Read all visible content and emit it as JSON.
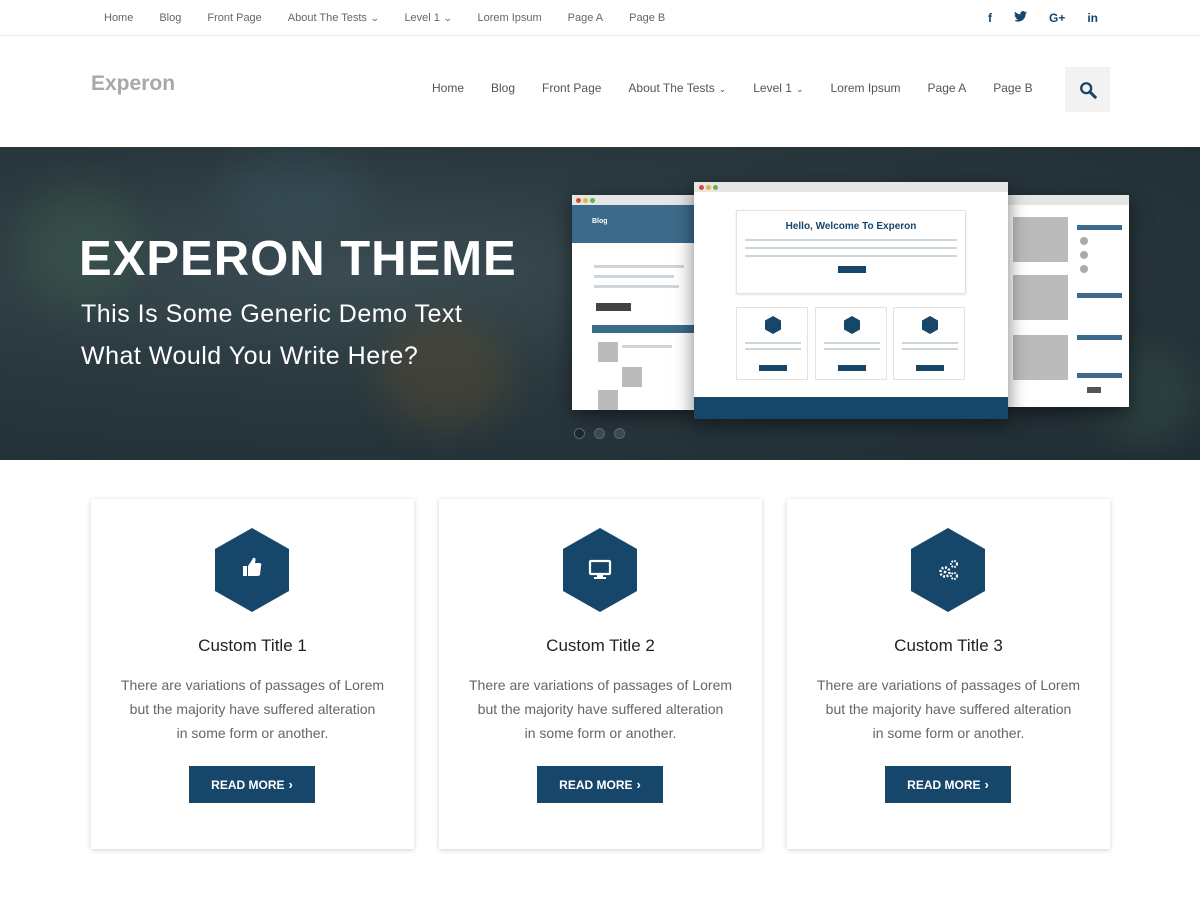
{
  "topbar": {
    "nav": [
      {
        "label": "Home"
      },
      {
        "label": "Blog"
      },
      {
        "label": "Front Page"
      },
      {
        "label": "About The Tests"
      },
      {
        "label": "Level 1"
      },
      {
        "label": "Lorem Ipsum"
      },
      {
        "label": "Page A"
      },
      {
        "label": "Page B"
      }
    ],
    "social": [
      {
        "label": "f",
        "icon": "facebook-icon"
      },
      {
        "label": "t",
        "icon": "twitter-icon"
      },
      {
        "label": "G+",
        "icon": "google-plus-icon"
      },
      {
        "label": "in",
        "icon": "linkedin-icon"
      }
    ]
  },
  "header": {
    "logo": "Experon",
    "nav": [
      {
        "label": "Home"
      },
      {
        "label": "Blog"
      },
      {
        "label": "Front Page"
      },
      {
        "label": "About The Tests"
      },
      {
        "label": "Level 1"
      },
      {
        "label": "Lorem Ipsum"
      },
      {
        "label": "Page A"
      },
      {
        "label": "Page B"
      }
    ],
    "search_icon": "search-icon"
  },
  "hero": {
    "title": "EXPERON THEME",
    "subtitle_line1": "This Is Some Generic Demo Text",
    "subtitle_line2": "What Would You Write Here?",
    "slides": 3,
    "active_slide": 1,
    "mockup": {
      "center_heading": "Hello, Welcome To Experon",
      "left_heading": "Blog"
    }
  },
  "cards": [
    {
      "title": "Custom Title 1",
      "icon": "thumbs-up-icon",
      "text1": "There are variations of passages of Lorem",
      "text2": "but the majority have suffered alteration",
      "text3": "in some form or another.",
      "button": "READ MORE"
    },
    {
      "title": "Custom Title 2",
      "icon": "monitor-icon",
      "text1": "There are variations of passages of Lorem",
      "text2": "but the majority have suffered alteration",
      "text3": "in some form or another.",
      "button": "READ MORE"
    },
    {
      "title": "Custom Title 3",
      "icon": "gears-icon",
      "text1": "There are variations of passages of Lorem",
      "text2": "but the majority have suffered alteration",
      "text3": "in some form or another.",
      "button": "READ MORE"
    }
  ],
  "colors": {
    "accent": "#17466b",
    "hero_bg": "#2b3a40",
    "logo": "#a8a8a8"
  }
}
